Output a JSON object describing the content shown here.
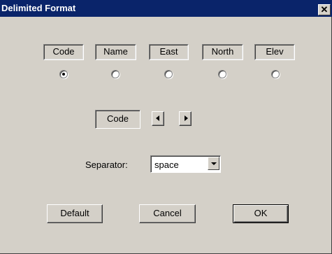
{
  "window": {
    "title": "Delimited Format",
    "close_glyph": "✕"
  },
  "fields": [
    {
      "label": "Code",
      "selected": true
    },
    {
      "label": "Name",
      "selected": false
    },
    {
      "label": "East",
      "selected": false
    },
    {
      "label": "North",
      "selected": false
    },
    {
      "label": "Elev",
      "selected": false
    }
  ],
  "current_field": "Code",
  "separator": {
    "label": "Separator:",
    "value": "space"
  },
  "buttons": {
    "default": "Default",
    "cancel": "Cancel",
    "ok": "OK"
  }
}
